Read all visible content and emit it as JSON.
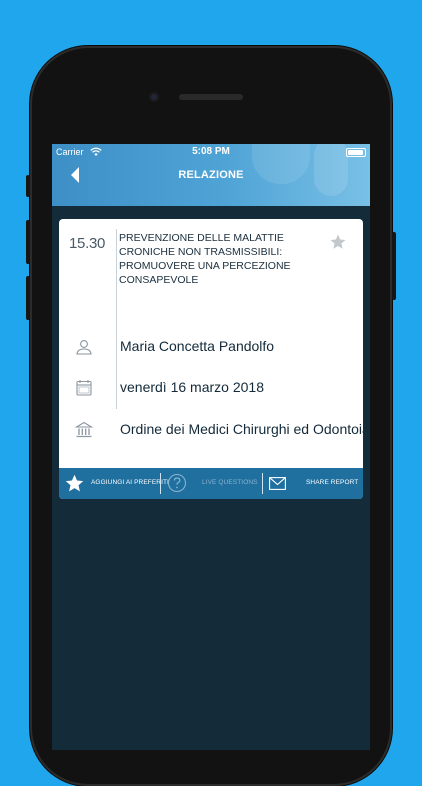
{
  "status_bar": {
    "carrier": "Carrier",
    "time": "5:08 PM"
  },
  "nav": {
    "title": "RELAZIONE"
  },
  "event": {
    "time": "15.30",
    "title": "PREVENZIONE DELLE MALATTIE CRONICHE NON TRASMISSIBILI: PROMUOVERE UNA PERCEZIONE CONSAPEVOLE",
    "speaker": "Maria Concetta Pandolfo",
    "date": "venerdì 16 marzo 2018",
    "venue": "Ordine dei Medici Chirurghi ed Odontoiatri",
    "favorite": false
  },
  "actions": {
    "add_favorites": "AGGIUNGI AI PREFERITI",
    "live_questions": "LIVE QUESTIONS",
    "share_report": "SHARE REPORT"
  },
  "icons": {
    "back": "chevron-left-icon",
    "star": "star-icon",
    "speaker": "person-icon",
    "date": "calendar-icon",
    "venue": "building-icon",
    "question": "question-icon",
    "mail": "envelope-icon"
  },
  "colors": {
    "background": "#1fa6ec",
    "navbar": "#4fa4d6",
    "screen_bg": "#142b3a",
    "action_bar": "#1f6f9f",
    "card": "#ffffff"
  }
}
